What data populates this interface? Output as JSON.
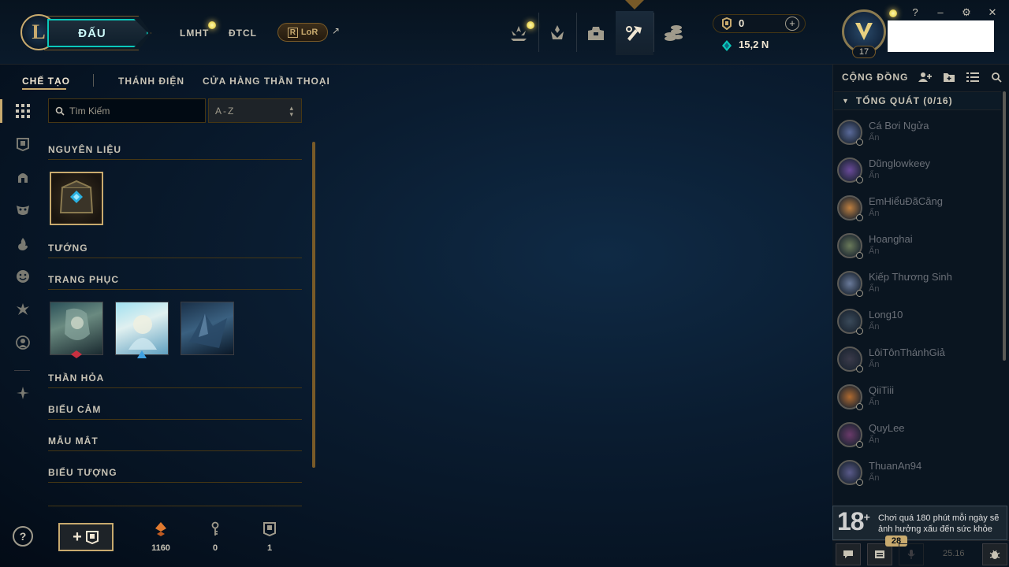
{
  "topnav": {
    "play_label": "ĐẤU",
    "links": [
      "LMHT",
      "ĐTCL"
    ],
    "lor_label": "LoR",
    "lor_ext": "↗",
    "icons": [
      "home-icon",
      "clash-icon",
      "collection-icon",
      "crafting-icon",
      "store-icon"
    ],
    "active_icon": "crafting-icon",
    "rp": "0",
    "blue_essence": "15,2 N"
  },
  "window_controls": [
    "?",
    "–",
    "⚙",
    "✕"
  ],
  "profile": {
    "level": "17"
  },
  "subtabs": [
    "CHẾ TẠO",
    "THÁNH ĐIỆN",
    "CỬA HÀNG THẦN THOẠI"
  ],
  "search": {
    "placeholder": "Tìm Kiếm"
  },
  "sort": {
    "value": "A-Z"
  },
  "sections": {
    "materials": "NGUYÊN LIỆU",
    "champions": "TƯỚNG",
    "skins": "TRANG PHỤC",
    "wards": "THẦN HỎA",
    "emotes": "BIỂU CẢM",
    "eyes": "MẪU MẮT",
    "icons": "BIỂU TƯỢNG"
  },
  "inventory": {
    "orange_essence": "1160",
    "keys": "0",
    "chests": "1"
  },
  "social": {
    "header": "CỘNG ĐỒNG",
    "group": "TỔNG QUÁT (0/16)",
    "friends": [
      {
        "name": "Cá Bơi Ngửa",
        "status": "Ẩn"
      },
      {
        "name": "Dũnglowkeey",
        "status": "Ẩn"
      },
      {
        "name": "EmHiểuĐãCăng",
        "status": "Ẩn"
      },
      {
        "name": "Hoanghai",
        "status": "Ẩn"
      },
      {
        "name": "Kiếp Thương Sinh",
        "status": "Ẩn"
      },
      {
        "name": "Long10",
        "status": "Ẩn"
      },
      {
        "name": "LôiTônThánhGiả",
        "status": "Ẩn"
      },
      {
        "name": "QiiTiii",
        "status": "Ẩn"
      },
      {
        "name": "QuyLee",
        "status": "Ẩn"
      },
      {
        "name": "ThuanAn94",
        "status": "Ẩn"
      }
    ],
    "warning_age": "18",
    "warning_text": "Chơi quá 180 phút mỗi ngày sẽ ảnh hưởng xấu đến sức khỏe",
    "missions_badge": "28",
    "version": "25.16"
  },
  "colors": {
    "gold": "#c8aa6e",
    "teal": "#0ac8b9",
    "bg": "#010a13"
  }
}
